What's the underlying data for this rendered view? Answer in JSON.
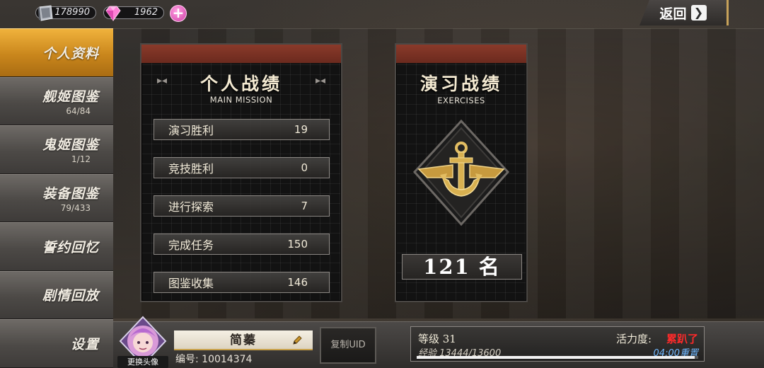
{
  "currency": {
    "steel": "178990",
    "gems": "1962",
    "steel_icon": "steel-ingot-icon",
    "gem_icon": "pink-gem-icon",
    "add_icon": "plus-icon"
  },
  "header": {
    "back_label": "返回",
    "back_icon": "chevron-right-icon"
  },
  "sidebar": {
    "items": [
      {
        "label": "个人资料",
        "sub": ""
      },
      {
        "label": "舰姬图鉴",
        "sub": "64/84"
      },
      {
        "label": "鬼姬图鉴",
        "sub": "1/12"
      },
      {
        "label": "装备图鉴",
        "sub": "79/433"
      },
      {
        "label": "誓约回忆",
        "sub": ""
      },
      {
        "label": "剧情回放",
        "sub": ""
      },
      {
        "label": "设置",
        "sub": ""
      }
    ],
    "active_index": 0
  },
  "personal": {
    "title": "个人战绩",
    "subtitle": "MAIN MISSION",
    "rows": [
      {
        "label": "演习胜利",
        "value": "19"
      },
      {
        "label": "竞技胜利",
        "value": "0"
      },
      {
        "label": "进行探索",
        "value": "7"
      },
      {
        "label": "完成任务",
        "value": "150"
      },
      {
        "label": "图鉴收集",
        "value": "146"
      }
    ]
  },
  "exercises": {
    "title": "演习战绩",
    "subtitle": "EXERCISES",
    "emblem_icon": "anchor-wings-emblem-icon",
    "rank": "121 名"
  },
  "profile": {
    "avatar_label": "更换头像",
    "name": "简蓁",
    "uid": "编号: 10014374",
    "copy_uid": "复制UID",
    "level": "等级 31",
    "exp": "经验 13444/13600",
    "exp_fraction": 0.9885,
    "vitality_label": "活力度:",
    "vitality_value": "累趴了",
    "reset": "04:00重置"
  },
  "colors": {
    "accent_active": "#e0a030",
    "panel_red": "#7a3022",
    "vitality_red": "#ff2a2a",
    "reset_blue": "#6fb8ff"
  }
}
